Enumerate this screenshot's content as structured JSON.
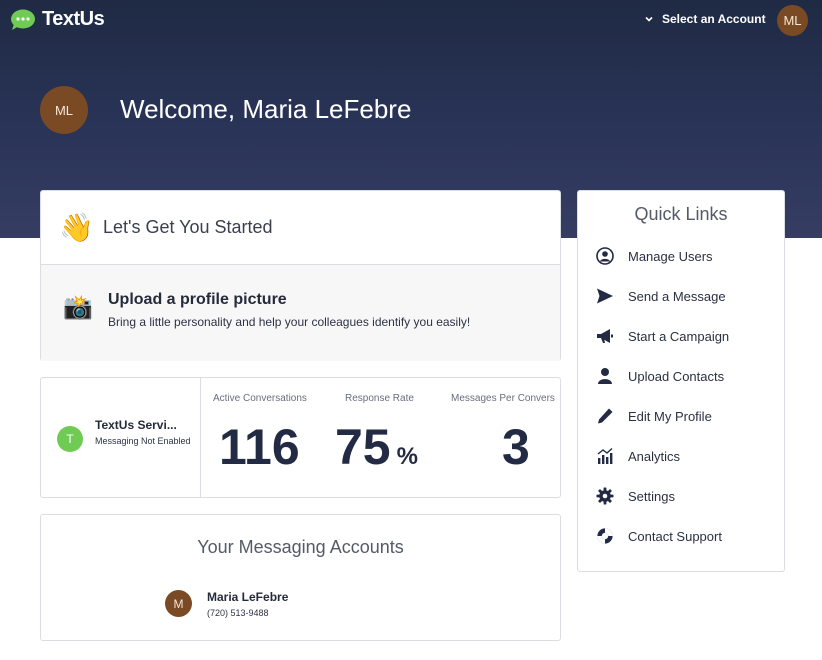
{
  "app": {
    "name": "TextUs"
  },
  "header": {
    "account_selector": "Select an Account",
    "user_initials": "ML"
  },
  "welcome": {
    "title": "Welcome, Maria LeFebre",
    "initials": "ML"
  },
  "getting_started": {
    "emoji": "👋",
    "title": "Let's Get You Started",
    "task": {
      "emoji": "📸",
      "title": "Upload a profile picture",
      "description": "Bring a little personality and help your colleagues identify you easily!"
    }
  },
  "stats": {
    "account": {
      "initial": "T",
      "name": "TextUs Servi...",
      "status": "Messaging Not Enabled"
    },
    "metrics": [
      {
        "label": "Active Conversations",
        "value": "116",
        "unit": ""
      },
      {
        "label": "Response Rate",
        "value": "75",
        "unit": "%"
      },
      {
        "label": "Messages Per Convers",
        "value": "3",
        "unit": ""
      }
    ]
  },
  "messaging_accounts": {
    "title": "Your Messaging Accounts",
    "items": [
      {
        "initial": "M",
        "name": "Maria LeFebre",
        "phone": "(720) 513-9488"
      }
    ]
  },
  "quick_links": {
    "title": "Quick Links",
    "items": [
      {
        "label": "Manage Users",
        "icon": "user-circle-icon"
      },
      {
        "label": "Send a Message",
        "icon": "paper-plane-icon"
      },
      {
        "label": "Start a Campaign",
        "icon": "megaphone-icon"
      },
      {
        "label": "Upload Contacts",
        "icon": "user-icon"
      },
      {
        "label": "Edit My Profile",
        "icon": "pencil-icon"
      },
      {
        "label": "Analytics",
        "icon": "analytics-icon"
      },
      {
        "label": "Settings",
        "icon": "gear-icon"
      },
      {
        "label": "Contact Support",
        "icon": "support-icon"
      }
    ]
  },
  "colors": {
    "header_dark": "#1f2a44",
    "logo_green": "#6fcb54",
    "avatar_brown": "#7a4a24",
    "metric_text": "#232a44"
  }
}
